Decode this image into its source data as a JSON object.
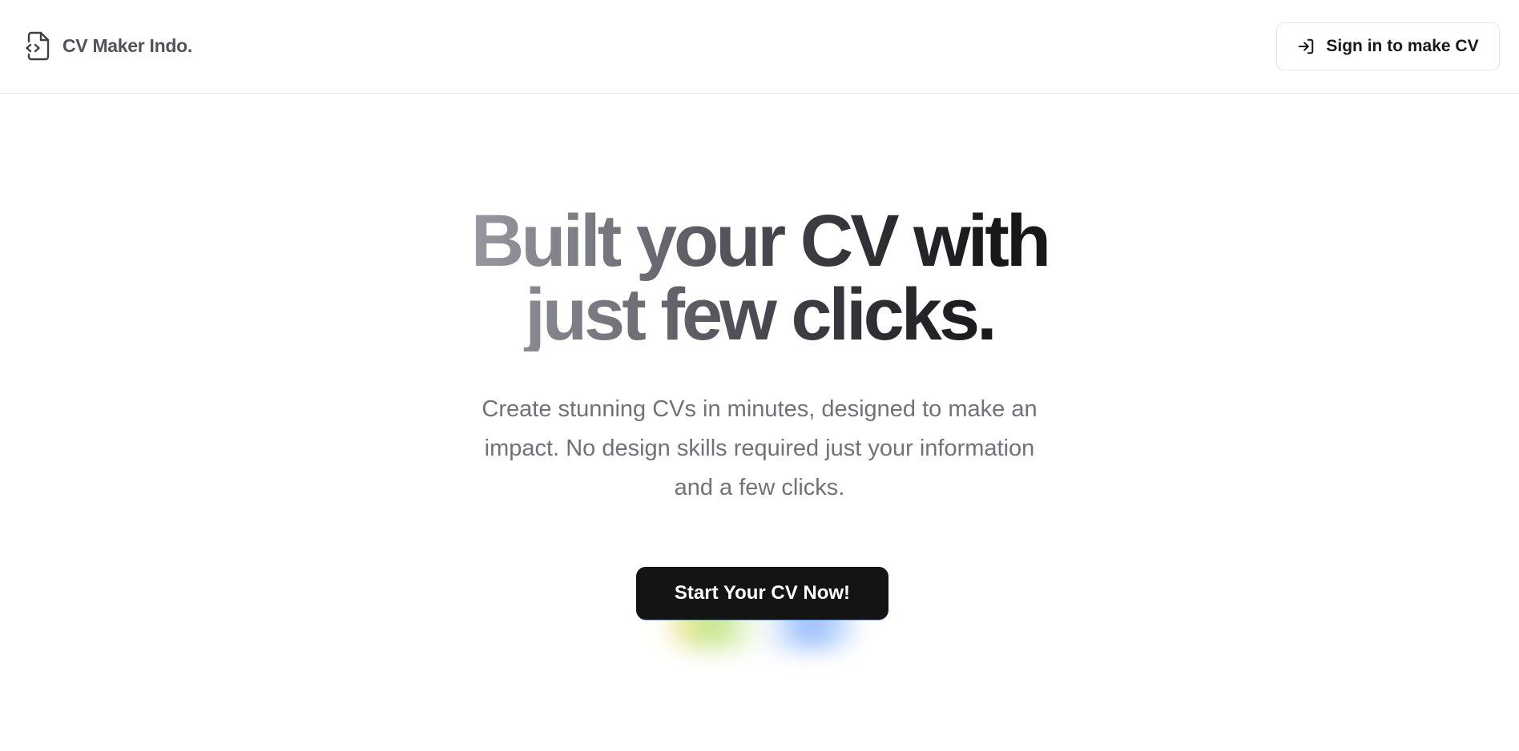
{
  "header": {
    "brand_name": "CV Maker Indo.",
    "brand_icon": "file-code-icon",
    "signin_label": "Sign in to make CV",
    "signin_icon": "log-in-icon"
  },
  "hero": {
    "headline": "Built your CV with just few clicks.",
    "subtitle": "Create stunning CVs in minutes, designed to make an impact. No design skills required just your information and a few clicks.",
    "cta_label": "Start Your CV Now!"
  },
  "colors": {
    "text_primary": "#18181b",
    "text_muted": "#71717a",
    "cta_background": "#141414"
  }
}
